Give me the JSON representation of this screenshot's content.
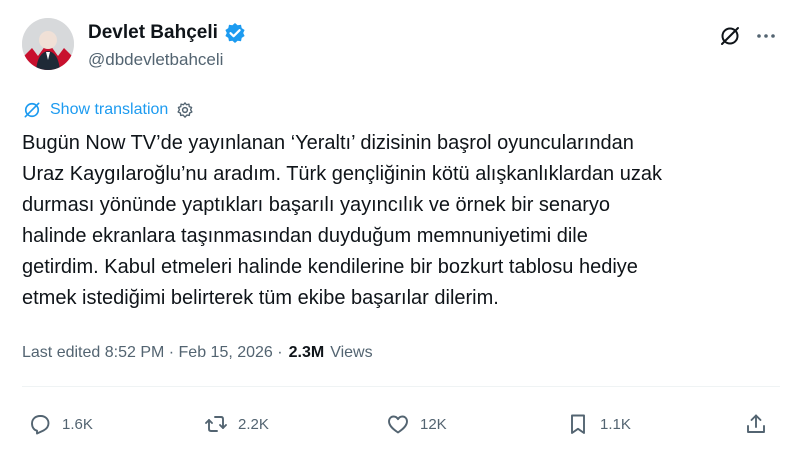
{
  "author": {
    "name": "Devlet Bahçeli",
    "handle": "@dbdevletbahceli",
    "verified_color": "#1d9bf0"
  },
  "translate": {
    "label": "Show translation"
  },
  "tweet": {
    "lines": [
      "Bugün Now TV’de yayınlanan ‘Yeraltı’ dizisinin başrol oyuncularından",
      "Uraz Kaygılaroğlu’nu aradım. Türk gençliğinin kötü alışkanlıklardan uzak",
      "durması yönünde yaptıkları başarılı yayıncılık ve örnek bir senaryo",
      "halinde ekranlara taşınmasından duyduğum memnuniyetimi dile",
      "getirdim. Kabul etmeleri halinde kendilerine bir bozkurt tablosu hediye",
      "etmek istediğimi belirterek tüm ekibe başarılar dilerim."
    ]
  },
  "meta": {
    "edited": "Last edited 8:52 PM · Feb 15, 2026 ·",
    "views_count": "2.3M",
    "views_label": "Views"
  },
  "actions": {
    "replies": "1.6K",
    "reposts": "2.2K",
    "likes": "12K",
    "bookmarks": "1.1K"
  },
  "icons": [
    "grok-icon",
    "more-icon",
    "translate-icon",
    "settings-icon",
    "verified-badge-icon",
    "reply-icon",
    "repost-icon",
    "like-icon",
    "bookmark-icon",
    "share-icon"
  ]
}
